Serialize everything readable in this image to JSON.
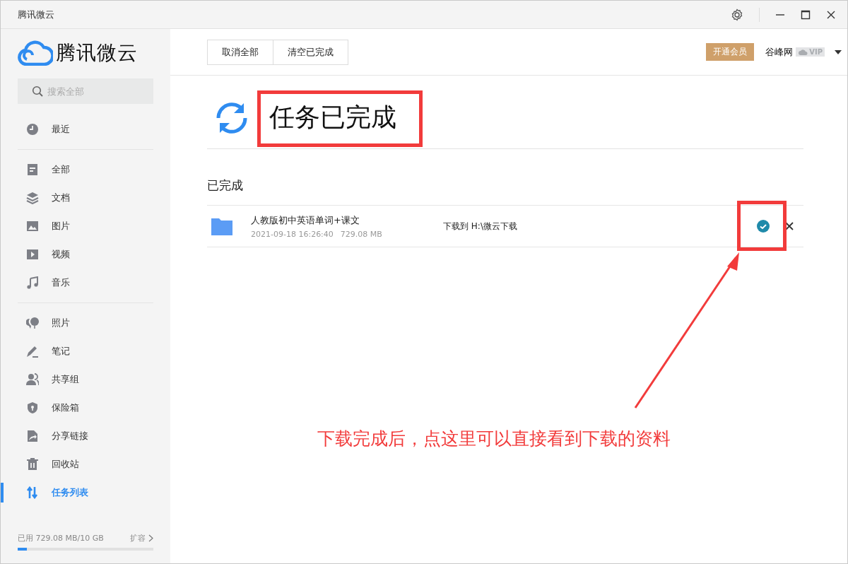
{
  "window": {
    "title": "腾讯微云"
  },
  "sidebar": {
    "logo": "腾讯微云",
    "search": {
      "placeholder": "搜索全部"
    },
    "sections": [
      [
        {
          "label": "最近",
          "selected": false
        }
      ],
      [
        {
          "label": "全部",
          "selected": false
        },
        {
          "label": "文档",
          "selected": false
        },
        {
          "label": "图片",
          "selected": false
        },
        {
          "label": "视频",
          "selected": false
        },
        {
          "label": "音乐",
          "selected": false
        }
      ],
      [
        {
          "label": "照片",
          "selected": false
        },
        {
          "label": "笔记",
          "selected": false
        },
        {
          "label": "共享组",
          "selected": false
        },
        {
          "label": "保险箱",
          "selected": false
        },
        {
          "label": "分享链接",
          "selected": false
        },
        {
          "label": "回收站",
          "selected": false
        },
        {
          "label": "任务列表",
          "selected": true
        }
      ]
    ],
    "storage": {
      "text": "已用 729.08 MB/10 GB",
      "expand": "扩容",
      "level": 0.07
    }
  },
  "toolbar": {
    "buttons": [
      "取消全部",
      "清空已完成"
    ],
    "vip_button": "开通会员",
    "user": "谷峰网",
    "vip_badge": "VIP"
  },
  "heading": "任务已完成",
  "section_title": "已完成",
  "tasks": [
    {
      "name": "人教版初中英语单词+课文",
      "date": "2021-09-18 16:26:40",
      "size": "729.08 MB",
      "destination": "下载到 H:\\微云下载",
      "done": true
    }
  ],
  "annotation": {
    "caption": "下载完成后，点这里可以直接看到下载的资料"
  }
}
